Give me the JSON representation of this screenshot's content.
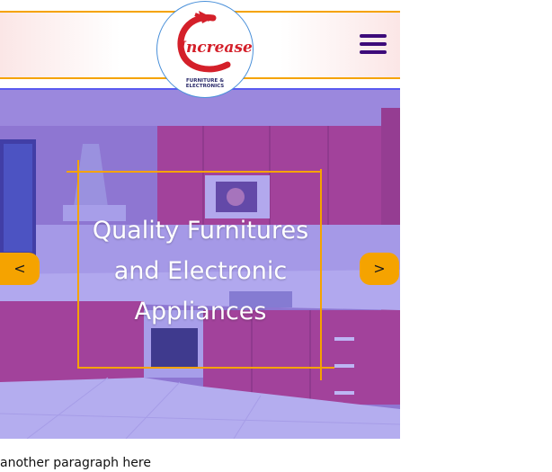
{
  "header": {
    "logo": {
      "brand_text": "Increase",
      "tagline_line1": "FURNITURE &",
      "tagline_line2": "ELECTRONICS"
    },
    "menu_icon": "hamburger-menu-icon"
  },
  "hero": {
    "title_line1": "Quality Furnitures",
    "title_line2": "and Electronic",
    "title_line3": "Appliances",
    "prev_label": "<",
    "next_label": ">"
  },
  "paragraph": "another paragraph here",
  "colors": {
    "accent": "#f5a300",
    "menu": "#3d0b7a",
    "tint": "#503cf0",
    "cabinet": "#c2457a",
    "logo_red": "#d4202a"
  }
}
